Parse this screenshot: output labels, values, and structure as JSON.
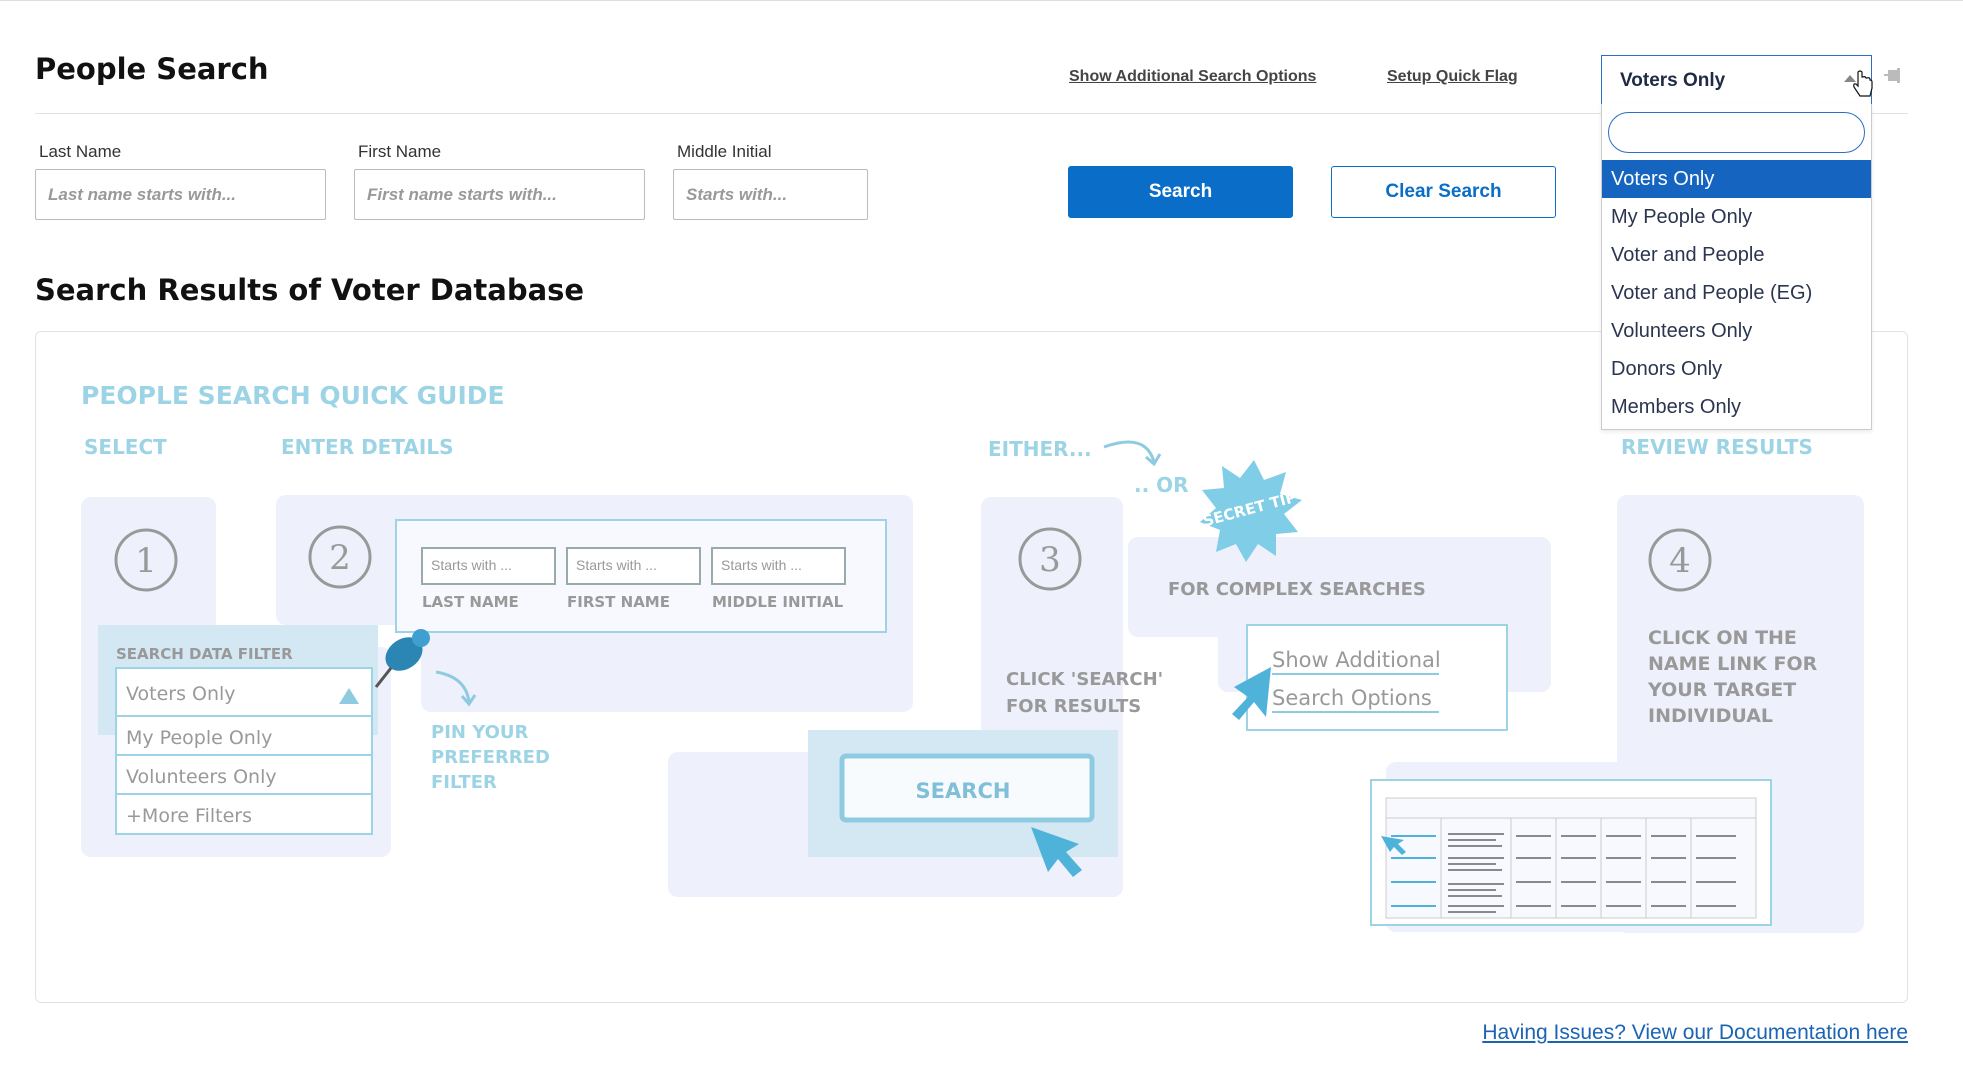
{
  "page": {
    "title": "People Search",
    "section_title": "Search Results of Voter Database"
  },
  "header_links": {
    "additional_options": "Show Additional Search Options",
    "quick_flag": "Setup Quick Flag"
  },
  "fields": {
    "last_name": {
      "label": "Last Name",
      "placeholder": "Last name starts with..."
    },
    "first_name": {
      "label": "First Name",
      "placeholder": "First name starts with..."
    },
    "middle_initial": {
      "label": "Middle Initial",
      "placeholder": "Starts with..."
    }
  },
  "buttons": {
    "search": "Search",
    "clear": "Clear Search"
  },
  "filter": {
    "selected": "Voters Only",
    "options": [
      "Voters Only",
      "My People Only",
      "Voter and People",
      "Voter and People (EG)",
      "Volunteers Only",
      "Donors Only",
      "Members Only"
    ]
  },
  "guide": {
    "title": "PEOPLE SEARCH QUICK GUIDE",
    "step_select": "SELECT",
    "step_enter": "ENTER DETAILS",
    "step_either": "EITHER...",
    "step_or": ".. OR",
    "step_review": "REVIEW RESULTS",
    "badge": "SECRET TIP",
    "num1": "1",
    "num2": "2",
    "num3": "3",
    "num4": "4",
    "mini_starts": "Starts with ...",
    "mini_last": "LAST NAME",
    "mini_first": "FIRST NAME",
    "mini_middle": "MIDDLE INITIAL",
    "filter_heading": "SEARCH DATA FILTER",
    "filter_selected": "Voters Only",
    "filter_items": [
      "My People Only",
      "Volunteers Only",
      "+More Filters"
    ],
    "pin_text": [
      "PIN YOUR",
      "PREFERRED",
      "FILTER"
    ],
    "click_search": [
      "CLICK 'SEARCH'",
      "FOR RESULTS"
    ],
    "search_btn": "SEARCH",
    "complex": "FOR COMPLEX SEARCHES",
    "show_additional": [
      "Show Additional",
      "Search Options"
    ],
    "review_text": [
      "CLICK ON THE",
      "NAME LINK FOR",
      "YOUR TARGET",
      "INDIVIDUAL"
    ]
  },
  "footer": {
    "doc_link": "Having Issues? View our Documentation here"
  },
  "colors": {
    "primary": "#0a6ec8",
    "guide_blue": "#8fcbe0",
    "guide_bg": "#eef0fb"
  }
}
